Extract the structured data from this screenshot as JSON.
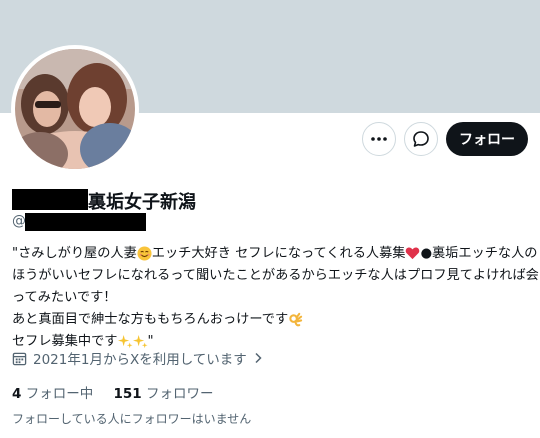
{
  "profile": {
    "display_name": "裏垢女子新潟",
    "handle_prefix": "@",
    "bio_lines": [
      "\"さみしがり屋の人妻",
      "エッチ大好き セフレになってくれる人募集",
      "●裏垢エッチな人の",
      "ほうがいいセフレになれるって聞いたことがあるからエッチな人はプロフ見てよければ会",
      "ってみたいです！",
      "あと真面目で紳士な方ももちろんおっけーです",
      "セフレ募集中です",
      "\""
    ],
    "joined": "2021年1月からXを利用しています",
    "following_count": "4",
    "following_label": "フォロー中",
    "followers_count": "151",
    "followers_label": "フォロワー",
    "followers_you_know": "フォローしている人にフォロワーはいません"
  },
  "actions": {
    "follow_label": "フォロー",
    "more_icon": "more-icon",
    "message_icon": "message-icon"
  },
  "colors": {
    "banner": "#cfd9de",
    "text_primary": "#0f1419",
    "text_secondary": "#536471",
    "follow_bg": "#0f1419"
  }
}
